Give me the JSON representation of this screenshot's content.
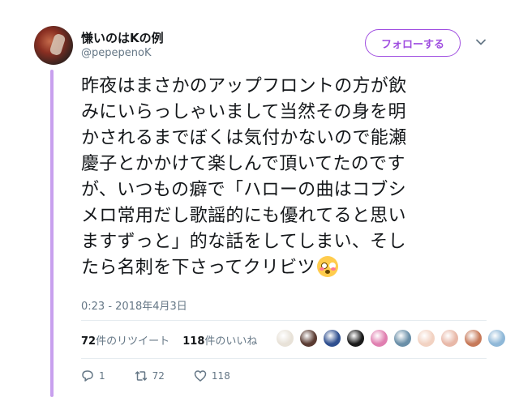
{
  "user": {
    "display_name": "慊いのはKの例",
    "screen_name": "@pepepenoK",
    "avatar_icon": "user-avatar"
  },
  "follow_button": {
    "label": "フォローする",
    "color": "#9f4de0"
  },
  "menu_icon": "chevron-down-icon",
  "tweet": {
    "lines": [
      "昨夜はまさかのアップフロントの方が飲",
      "みにいらっしゃいまして当然その身を明",
      "かされるまでぼくは気付かないので能瀬",
      "慶子とかかけて楽しんで頂いてたのです",
      "が、いつもの癖で「ハローの曲はコブシ",
      "メロ常用だし歌謡的にも優れてると思い",
      "ますずっと」的な話をしてしまい、そし",
      "たら名刺を下さってクリビツ"
    ],
    "emoji": "flushed-face-emoji",
    "timestamp": "0:23 - 2018年4月3日"
  },
  "stats": {
    "retweets_count": "72",
    "retweets_label": "件のリツイート",
    "likes_count": "118",
    "likes_label": "件のいいね"
  },
  "likers": {
    "colors": [
      "#e8e2d8",
      "#5a3b32",
      "#2f4f8f",
      "#1a1a1a",
      "#e07fb0",
      "#6a8fa8",
      "#f2d2c2",
      "#e8b8a8",
      "#c77a5a",
      "#8fb8d8"
    ]
  },
  "actions": {
    "reply_count": "1",
    "retweet_count": "72",
    "like_count": "118",
    "reply_icon": "reply-icon",
    "retweet_icon": "retweet-icon",
    "like_icon": "heart-icon"
  },
  "accent_color": "#c8a0ee"
}
